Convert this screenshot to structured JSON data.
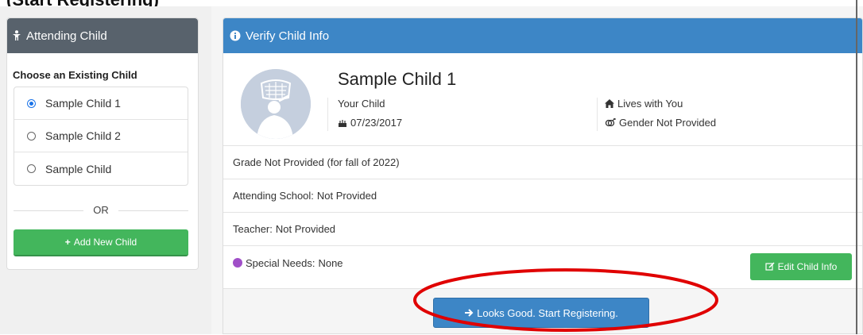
{
  "header": {
    "clipped_title": "(Start Registering)"
  },
  "left_panel": {
    "title": "Attending Child",
    "choose_label": "Choose an Existing Child",
    "children": [
      {
        "label": "Sample Child 1",
        "selected": true
      },
      {
        "label": "Sample Child 2",
        "selected": false
      },
      {
        "label": "Sample Child",
        "selected": false
      }
    ],
    "or_text": "OR",
    "add_button": "Add New Child"
  },
  "right_panel": {
    "title": "Verify Child Info",
    "child_name": "Sample Child 1",
    "relationship": "Your Child",
    "birthdate": "07/23/2017",
    "lives_with": "Lives with You",
    "gender": "Gender Not Provided",
    "grade": "Grade Not Provided (for fall of 2022)",
    "school_label": "Attending School:",
    "school_value": "Not Provided",
    "teacher_label": "Teacher:",
    "teacher_value": "Not Provided",
    "special_needs_label": "Special Needs:",
    "special_needs_value": "None",
    "edit_button": "Edit Child Info",
    "start_button": "Looks Good. Start Registering."
  },
  "colors": {
    "left_header": "#58626c",
    "right_header": "#3d86c6",
    "green_button": "#43b65c",
    "annotation_red": "#e00000"
  }
}
